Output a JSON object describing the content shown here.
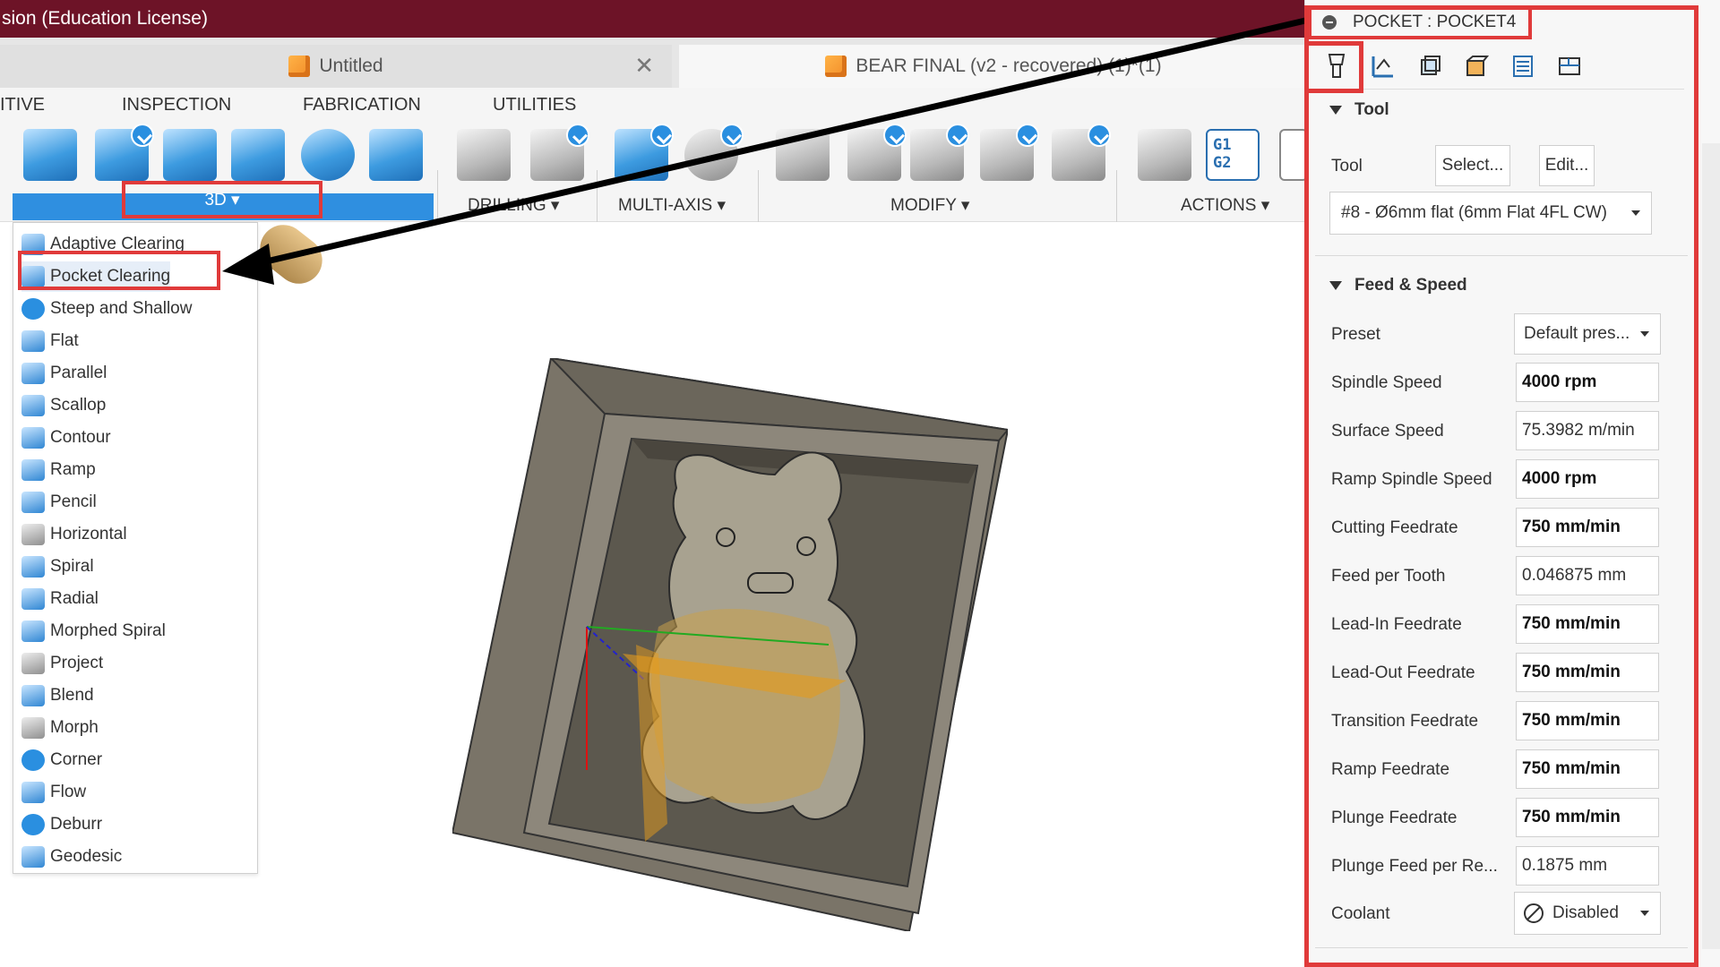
{
  "app": {
    "title": "sion (Education License)"
  },
  "doc_tabs": [
    {
      "label": "Untitled",
      "active": false
    },
    {
      "label": "BEAR FINAL (v2 - recovered) (1)*(1)",
      "active": true
    }
  ],
  "ribbon": {
    "tabs": [
      "ITIVE",
      "INSPECTION",
      "FABRICATION",
      "UTILITIES"
    ],
    "groups": {
      "g3d": "3D ▾",
      "drilling": "DRILLING ▾",
      "multiaxis": "MULTI-AXIS ▾",
      "modify": "MODIFY ▾",
      "actions": "ACTIONS ▾"
    },
    "accent": "#2f8fe0"
  },
  "menu_3d": {
    "items": [
      "Adaptive Clearing",
      "Pocket Clearing",
      "Steep and Shallow",
      "Flat",
      "Parallel",
      "Scallop",
      "Contour",
      "Ramp",
      "Pencil",
      "Horizontal",
      "Spiral",
      "Radial",
      "Morphed Spiral",
      "Project",
      "Blend",
      "Morph",
      "Corner",
      "Flow",
      "Deburr",
      "Geodesic"
    ],
    "highlighted": "Pocket Clearing"
  },
  "panel": {
    "title": "POCKET : POCKET4",
    "tool_section": "Tool",
    "tool_label": "Tool",
    "select_btn": "Select...",
    "edit_btn": "Edit...",
    "tool_value": "#8 - Ø6mm flat (6mm Flat 4FL CW)",
    "feed_section": "Feed & Speed",
    "preset_label": "Preset",
    "preset_value": "Default pres...",
    "fields": [
      {
        "label": "Spindle Speed",
        "value": "4000 rpm",
        "bold": true
      },
      {
        "label": "Surface Speed",
        "value": "75.3982 m/min",
        "bold": false
      },
      {
        "label": "Ramp Spindle Speed",
        "value": "4000 rpm",
        "bold": true
      },
      {
        "label": "Cutting Feedrate",
        "value": "750 mm/min",
        "bold": true
      },
      {
        "label": "Feed per Tooth",
        "value": "0.046875 mm",
        "bold": false
      },
      {
        "label": "Lead-In Feedrate",
        "value": "750 mm/min",
        "bold": true
      },
      {
        "label": "Lead-Out Feedrate",
        "value": "750 mm/min",
        "bold": true
      },
      {
        "label": "Transition Feedrate",
        "value": "750 mm/min",
        "bold": true
      },
      {
        "label": "Ramp Feedrate",
        "value": "750 mm/min",
        "bold": true
      },
      {
        "label": "Plunge Feedrate",
        "value": "750 mm/min",
        "bold": true
      },
      {
        "label": "Plunge Feed per Re...",
        "value": "0.1875 mm",
        "bold": false
      }
    ],
    "coolant_label": "Coolant",
    "coolant_value": "Disabled"
  },
  "annotation_color": "#e03a3a",
  "titlebar_color": "#6d1327"
}
